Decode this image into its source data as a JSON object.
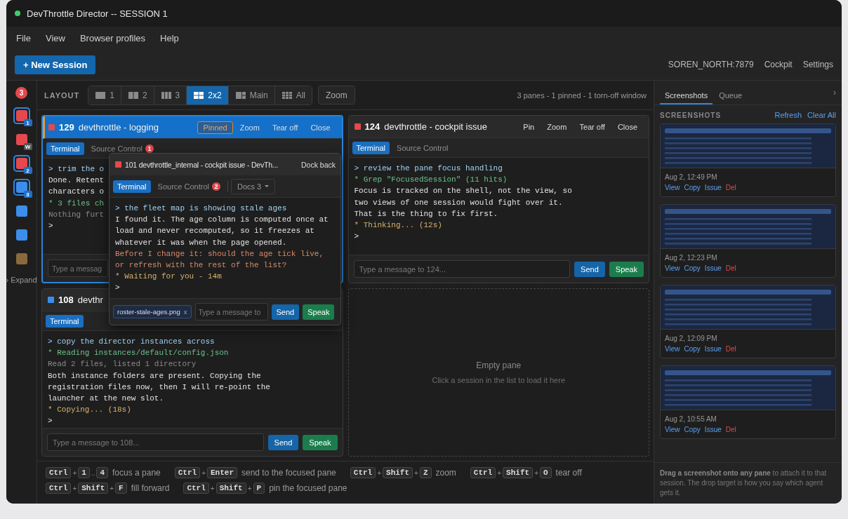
{
  "window": {
    "title": "DevThrottle Director -- SESSION 1"
  },
  "menu": [
    "File",
    "View",
    "Browser profiles",
    "Help"
  ],
  "toolbar": {
    "new_session": "+ New Session",
    "host": "SOREN_NORTH:7879",
    "links": [
      "Cockpit",
      "Settings"
    ]
  },
  "rail": {
    "alert_count": "3",
    "sessions": [
      {
        "color": "#e5484d",
        "in_pane": true,
        "badge": {
          "text": "1",
          "color": "#1f6fc8"
        }
      },
      {
        "color": "#e5484d",
        "in_pane": false,
        "badge": {
          "text": "W",
          "color": "#555555"
        }
      },
      {
        "color": "#e5484d",
        "in_pane": true,
        "badge": {
          "text": "2",
          "color": "#1f6fc8"
        }
      },
      {
        "color": "#3b8eea",
        "in_pane": true,
        "badge": {
          "text": "3",
          "color": "#1f6fc8"
        }
      },
      {
        "color": "#3b8eea",
        "in_pane": false
      },
      {
        "color": "#3b8eea",
        "in_pane": false
      },
      {
        "color": "#8a6a3a",
        "in_pane": false
      }
    ],
    "expand": "› Expand"
  },
  "layout": {
    "label": "LAYOUT",
    "options": [
      {
        "label": "1",
        "kind": "single",
        "selected": false
      },
      {
        "label": "2",
        "kind": "two",
        "selected": false
      },
      {
        "label": "3",
        "kind": "three",
        "selected": false
      },
      {
        "label": "2x2",
        "kind": "grid",
        "selected": true
      },
      {
        "label": "Main",
        "kind": "main",
        "selected": false
      },
      {
        "label": "All",
        "kind": "all",
        "selected": false
      }
    ],
    "zoom": "Zoom",
    "summary": "3 panes - 1 pinned - 1 torn-off window"
  },
  "panes": [
    {
      "kind": "session",
      "id": "129",
      "title": "devthrottle - logging",
      "color": "#e5484d",
      "focused": true,
      "actions": [
        {
          "label": "Pinned",
          "on": true
        },
        {
          "label": "Zoom",
          "on": false
        },
        {
          "label": "Tear off",
          "on": false
        },
        {
          "label": "Close",
          "on": false
        }
      ],
      "tabs": [
        {
          "label": "Terminal",
          "selected": true
        },
        {
          "label": "Source Control",
          "selected": false,
          "badge": "1"
        }
      ],
      "lines": [
        {
          "kind": "prompt",
          "text": "> trim the o"
        },
        {
          "kind": "text",
          "text": "Done. Retent"
        },
        {
          "kind": "text",
          "text": "characters o"
        },
        {
          "kind": "tool",
          "text": "* 3 files ch"
        },
        {
          "kind": "dim",
          "text": "Nothing furt"
        },
        {
          "kind": "text",
          "text": ">"
        }
      ],
      "input": {
        "placeholder": "Type a messag"
      }
    },
    {
      "kind": "session",
      "id": "124",
      "title": "devthrottle - cockpit issue",
      "color": "#e5484d",
      "focused": false,
      "actions": [
        {
          "label": "Pin",
          "on": false
        },
        {
          "label": "Zoom",
          "on": false
        },
        {
          "label": "Tear off",
          "on": false
        },
        {
          "label": "Close",
          "on": false
        }
      ],
      "tabs": [
        {
          "label": "Terminal",
          "selected": true
        },
        {
          "label": "Source Control",
          "selected": false
        }
      ],
      "lines": [
        {
          "kind": "prompt",
          "text": "> review the pane focus handling"
        },
        {
          "kind": "tool",
          "text": "* Grep \"FocusedSession\" (11 hits)"
        },
        {
          "kind": "text",
          "text": "Focus is tracked on the shell, not the view, so"
        },
        {
          "kind": "text",
          "text": "two views of one session would fight over it."
        },
        {
          "kind": "text",
          "text": "That is the thing to fix first."
        },
        {
          "kind": "status",
          "text": "* Thinking... (12s)"
        },
        {
          "kind": "text",
          "text": ">"
        }
      ],
      "input": {
        "placeholder": "Type a message to 124..."
      },
      "buttons": [
        {
          "label": "Send",
          "kind": "send"
        },
        {
          "label": "Speak",
          "kind": "speak"
        }
      ]
    },
    {
      "kind": "session",
      "id": "108",
      "title": "devthr",
      "color": "#3b8eea",
      "focused": false,
      "tabs": [
        {
          "label": "Terminal",
          "selected": true
        }
      ],
      "lines": [
        {
          "kind": "prompt",
          "text": "> copy the director instances across"
        },
        {
          "kind": "tool",
          "text": "* Reading instances/default/config.json"
        },
        {
          "kind": "dim",
          "text": "Read 2 files, listed 1 directory"
        },
        {
          "kind": "text",
          "text": "Both instance folders are present. Copying the"
        },
        {
          "kind": "text",
          "text": "registration files now, then I will re-point the"
        },
        {
          "kind": "text",
          "text": "launcher at the new slot."
        },
        {
          "kind": "status",
          "text": "* Copying... (18s)"
        },
        {
          "kind": "text",
          "text": ">"
        }
      ],
      "input": {
        "placeholder": "Type a message to 108..."
      },
      "buttons": [
        {
          "label": "Send",
          "kind": "send"
        },
        {
          "label": "Speak",
          "kind": "speak"
        }
      ]
    },
    {
      "kind": "empty",
      "title": "Empty pane",
      "hint": "Click a session in the list to load it here"
    }
  ],
  "torn_off": {
    "title": "101 devthrottle_internal - cockpit issue - DevTh...",
    "color": "#e5484d",
    "action": "Dock back",
    "tabs": [
      {
        "label": "Terminal",
        "selected": true
      },
      {
        "label": "Source Control",
        "selected": false,
        "badge": "2"
      }
    ],
    "dropdown": "Docs 3",
    "lines": [
      {
        "kind": "prompt",
        "text": "> the fleet map is showing stale ages"
      },
      {
        "kind": "text",
        "text": "I found it. The age column is computed once at"
      },
      {
        "kind": "text",
        "text": "load and never recomputed, so it freezes at"
      },
      {
        "kind": "text",
        "text": "whatever it was when the page opened."
      },
      {
        "kind": "question",
        "text": "Before I change it: should the age tick live,"
      },
      {
        "kind": "question",
        "text": "or refresh with the rest of the list?"
      },
      {
        "kind": "status",
        "text": "* Waiting for you - 14m"
      },
      {
        "kind": "text",
        "text": ">"
      }
    ],
    "attachment": {
      "name": "roster-stale-ages.png",
      "remove": "x"
    },
    "input": {
      "placeholder": "Type a message to"
    },
    "buttons": [
      {
        "label": "Send",
        "kind": "send"
      },
      {
        "label": "Speak",
        "kind": "speak"
      }
    ]
  },
  "shortcuts": [
    [
      {
        "parts": [
          {
            "kind": "key",
            "text": "Ctrl"
          },
          {
            "kind": "sep",
            "text": "+"
          },
          {
            "kind": "key",
            "text": "1"
          },
          {
            "kind": "sep",
            "text": ".."
          },
          {
            "kind": "key",
            "text": "4"
          }
        ],
        "label": "focus a pane"
      },
      {
        "parts": [
          {
            "kind": "key",
            "text": "Ctrl"
          },
          {
            "kind": "sep",
            "text": "+"
          },
          {
            "kind": "key",
            "text": "Enter"
          }
        ],
        "label": "send to the focused pane"
      },
      {
        "parts": [
          {
            "kind": "key",
            "text": "Ctrl"
          },
          {
            "kind": "sep",
            "text": "+"
          },
          {
            "kind": "key",
            "text": "Shift"
          },
          {
            "kind": "sep",
            "text": "+"
          },
          {
            "kind": "key",
            "text": "Z"
          }
        ],
        "label": "zoom"
      },
      {
        "parts": [
          {
            "kind": "key",
            "text": "Ctrl"
          },
          {
            "kind": "sep",
            "text": "+"
          },
          {
            "kind": "key",
            "text": "Shift"
          },
          {
            "kind": "sep",
            "text": "+"
          },
          {
            "kind": "key",
            "text": "O"
          }
        ],
        "label": "tear off"
      }
    ],
    [
      {
        "parts": [
          {
            "kind": "key",
            "text": "Ctrl"
          },
          {
            "kind": "sep",
            "text": "+"
          },
          {
            "kind": "key",
            "text": "Shift"
          },
          {
            "kind": "sep",
            "text": "+"
          },
          {
            "kind": "key",
            "text": "F"
          }
        ],
        "label": "fill forward"
      },
      {
        "parts": [
          {
            "kind": "key",
            "text": "Ctrl"
          },
          {
            "kind": "sep",
            "text": "+"
          },
          {
            "kind": "key",
            "text": "Shift"
          },
          {
            "kind": "sep",
            "text": "+"
          },
          {
            "kind": "key",
            "text": "P"
          }
        ],
        "label": "pin the focused pane"
      }
    ]
  ],
  "side_panel": {
    "tabs": [
      {
        "label": "Screenshots",
        "selected": true
      },
      {
        "label": "Queue",
        "selected": false
      }
    ],
    "collapse": "›",
    "heading": "SCREENSHOTS",
    "actions": [
      "Refresh",
      "Clear All"
    ],
    "screenshots": [
      {
        "time": "Aug 2, 12:49 PM",
        "actions": [
          {
            "label": "View",
            "kind": "link"
          },
          {
            "label": "Copy",
            "kind": "link"
          },
          {
            "label": "Issue",
            "kind": "link"
          },
          {
            "label": "Del",
            "kind": "danger"
          }
        ]
      },
      {
        "time": "Aug 2, 12:23 PM",
        "actions": [
          {
            "label": "View",
            "kind": "link"
          },
          {
            "label": "Copy",
            "kind": "link"
          },
          {
            "label": "Issue",
            "kind": "link"
          },
          {
            "label": "Del",
            "kind": "danger"
          }
        ]
      },
      {
        "time": "Aug 2, 12:09 PM",
        "actions": [
          {
            "label": "View",
            "kind": "link"
          },
          {
            "label": "Copy",
            "kind": "link"
          },
          {
            "label": "Issue",
            "kind": "link"
          },
          {
            "label": "Del",
            "kind": "danger"
          }
        ]
      },
      {
        "time": "Aug 2, 10:55 AM",
        "actions": [
          {
            "label": "View",
            "kind": "link"
          },
          {
            "label": "Copy",
            "kind": "link"
          },
          {
            "label": "Issue",
            "kind": "link"
          },
          {
            "label": "Del",
            "kind": "danger"
          }
        ]
      }
    ],
    "hint": "**Drag a screenshot onto any pane** to attach it to that session. The drop target is how you say which agent gets it."
  }
}
